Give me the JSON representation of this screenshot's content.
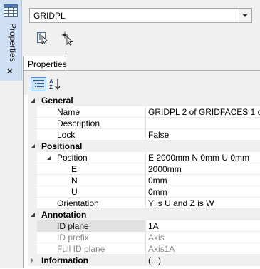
{
  "dock": {
    "title": "Properties",
    "close_glyph": "×",
    "icon": "table-icon"
  },
  "header": {
    "combo_value": "GRIDPL",
    "combo_icon": "chevron-down-icon",
    "tools": [
      "pick-element-icon",
      "pick-point-icon"
    ]
  },
  "tabs": [
    {
      "label": "Properties",
      "active": true
    }
  ],
  "grid_toolbar": {
    "categorized_icon": "categorized-list-icon",
    "sort_icon": "sort-alphabetical-icon",
    "az_top": "A",
    "az_bottom": "Z"
  },
  "rows": [
    {
      "kind": "cat",
      "name": "General",
      "expanded": true
    },
    {
      "kind": "prop",
      "name": "Name",
      "value": "GRIDPL 2 of GRIDFACES 1 of F"
    },
    {
      "kind": "prop",
      "name": "Description",
      "value": ""
    },
    {
      "kind": "prop",
      "name": "Lock",
      "value": "False"
    },
    {
      "kind": "cat",
      "name": "Positional",
      "expanded": true
    },
    {
      "kind": "sub",
      "name": "Position",
      "value": "E 2000mm N 0mm U 0mm",
      "expanded": true
    },
    {
      "kind": "subprop",
      "name": "E",
      "value": "2000mm"
    },
    {
      "kind": "subprop",
      "name": "N",
      "value": "0mm"
    },
    {
      "kind": "subprop",
      "name": "U",
      "value": "0mm"
    },
    {
      "kind": "prop",
      "name": "Orientation",
      "value": "Y is U and Z is W"
    },
    {
      "kind": "cat",
      "name": "Annotation",
      "expanded": true
    },
    {
      "kind": "prop",
      "name": "ID plane",
      "value": "1A",
      "selected": true
    },
    {
      "kind": "prop",
      "name": "ID prefix",
      "value": "Axis",
      "disabled": true
    },
    {
      "kind": "prop",
      "name": "Full ID plane",
      "value": "Axis1A",
      "disabled": true
    },
    {
      "kind": "cat",
      "name": "Information",
      "value": "(...)",
      "expanded": false
    }
  ]
}
